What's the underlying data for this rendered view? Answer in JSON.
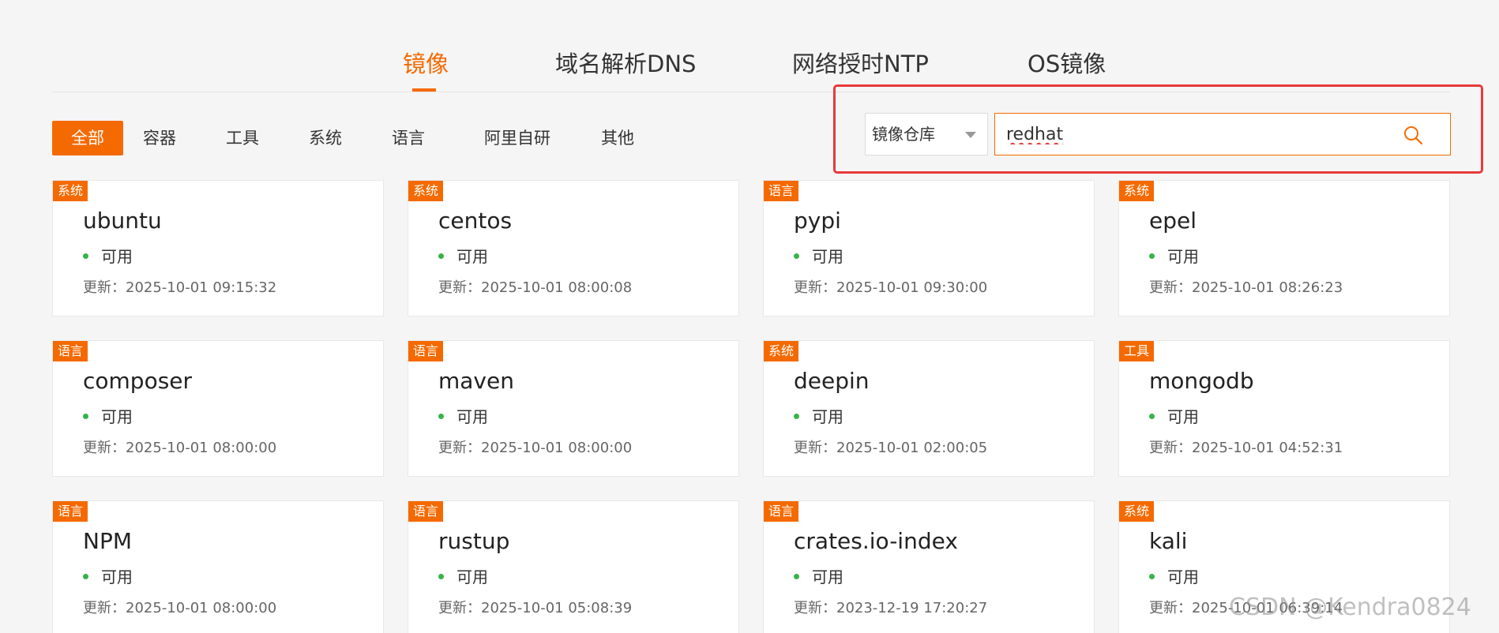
{
  "main_tabs": [
    {
      "label": "镜像",
      "active": true
    },
    {
      "label": "域名解析DNS",
      "active": false
    },
    {
      "label": "网络授时NTP",
      "active": false
    },
    {
      "label": "OS镜像",
      "active": false
    }
  ],
  "filters": [
    {
      "label": "全部",
      "active": true
    },
    {
      "label": "容器",
      "active": false
    },
    {
      "label": "工具",
      "active": false
    },
    {
      "label": "系统",
      "active": false
    },
    {
      "label": "语言",
      "active": false
    },
    {
      "label": "阿里自研",
      "active": false
    },
    {
      "label": "其他",
      "active": false
    }
  ],
  "search": {
    "select_value": "镜像仓库",
    "query": "redhat"
  },
  "cards": [
    {
      "tag": "系统",
      "name": "ubuntu",
      "status": "可用",
      "updated": "更新：2025-10-01 09:15:32"
    },
    {
      "tag": "系统",
      "name": "centos",
      "status": "可用",
      "updated": "更新：2025-10-01 08:00:08"
    },
    {
      "tag": "语言",
      "name": "pypi",
      "status": "可用",
      "updated": "更新：2025-10-01 09:30:00"
    },
    {
      "tag": "系统",
      "name": "epel",
      "status": "可用",
      "updated": "更新：2025-10-01 08:26:23"
    },
    {
      "tag": "语言",
      "name": "composer",
      "status": "可用",
      "updated": "更新：2025-10-01 08:00:00"
    },
    {
      "tag": "语言",
      "name": "maven",
      "status": "可用",
      "updated": "更新：2025-10-01 08:00:00"
    },
    {
      "tag": "系统",
      "name": "deepin",
      "status": "可用",
      "updated": "更新：2025-10-01 02:00:05"
    },
    {
      "tag": "工具",
      "name": "mongodb",
      "status": "可用",
      "updated": "更新：2025-10-01 04:52:31"
    },
    {
      "tag": "语言",
      "name": "NPM",
      "status": "可用",
      "updated": "更新：2025-10-01 08:00:00"
    },
    {
      "tag": "语言",
      "name": "rustup",
      "status": "可用",
      "updated": "更新：2025-10-01 05:08:39"
    },
    {
      "tag": "语言",
      "name": "crates.io-index",
      "status": "可用",
      "updated": "更新：2023-12-19 17:20:27"
    },
    {
      "tag": "系统",
      "name": "kali",
      "status": "可用",
      "updated": "更新：2025-10-01 06:39:14"
    }
  ],
  "watermark": "CSDN @Kendra0824",
  "colors": {
    "accent": "#f56a00",
    "status_ok": "#35b34a",
    "highlight": "#e83a3a"
  }
}
